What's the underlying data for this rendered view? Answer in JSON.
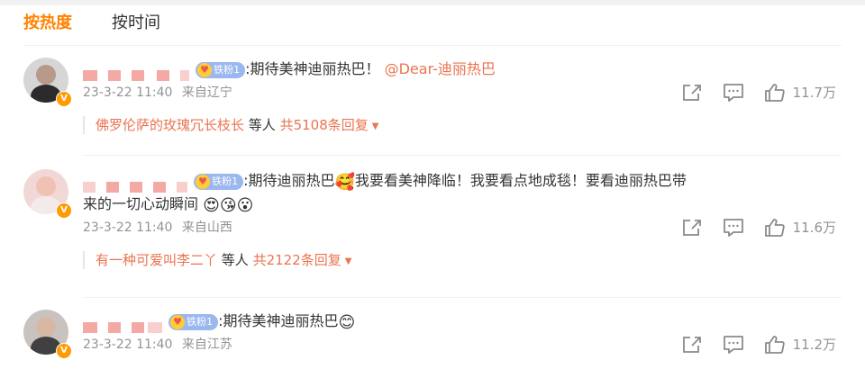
{
  "tabs": [
    {
      "label": "按热度",
      "active": true
    },
    {
      "label": "按时间",
      "active": false
    }
  ],
  "colors": {
    "accent": "#ff8200",
    "link": "#eb7350",
    "meta": "#939393",
    "fan_badge": "#9bb7ef",
    "verified": "#ff9a00"
  },
  "comments": [
    {
      "fan_badge": "铁粉1",
      "text_before": ":期待美神迪丽热巴！",
      "mention": "@Dear-迪丽热巴",
      "date": "23-3-22 11:40",
      "location": "来自辽宁",
      "likes": "11.7万",
      "reply_user": "佛罗伦萨的玫瑰冗长枝长",
      "reply_mid": "等人",
      "reply_count": "共5108条回复"
    },
    {
      "fan_badge": "铁粉1",
      "text_before": ":期待迪丽热巴",
      "text_mid": "我要看美神降临！我要看点地成毯！要看迪丽热巴带",
      "text_line2": "来的一切心动瞬间",
      "date": "23-3-22 11:40",
      "location": "来自山西",
      "likes": "11.6万",
      "reply_user": "有一种可爱叫李二丫",
      "reply_mid": "等人",
      "reply_count": "共2122条回复"
    },
    {
      "fan_badge": "铁粉1",
      "text_before": ":期待美神迪丽热巴",
      "date": "23-3-22 11:40",
      "location": "来自江苏",
      "likes": "11.2万"
    }
  ],
  "icons": {
    "share": "share-icon",
    "comment": "comment-icon",
    "like": "thumbs-up-icon",
    "verified": "verified-v-icon",
    "caret": "caret-down-icon"
  }
}
